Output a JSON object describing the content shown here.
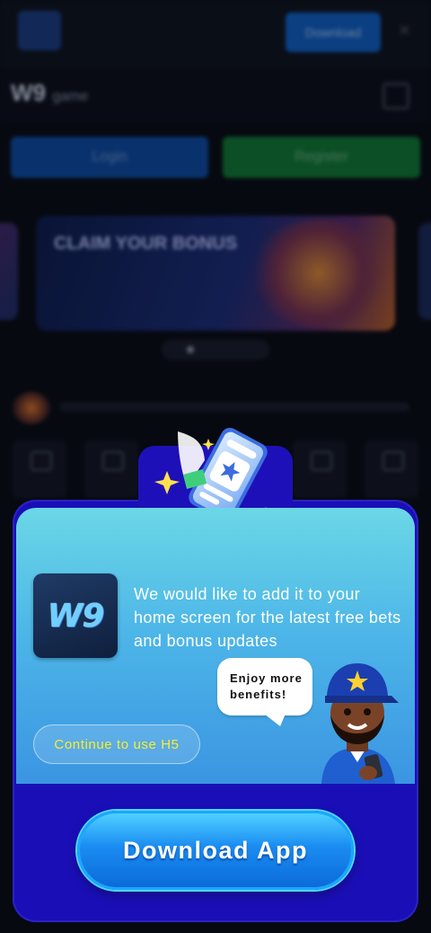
{
  "background": {
    "top_download_label": "Download",
    "brand": "W9",
    "brand_suffix": "game",
    "login_label": "Login",
    "register_label": "Register",
    "banner_title": "CLAIM YOUR BONUS"
  },
  "popup": {
    "app_icon_text": "W9",
    "message": "We would like to add it to your home screen for the latest free bets and bonus updates",
    "bubble_text": "Enjoy more benefits!",
    "continue_label": "Continue to use H5",
    "download_label": "Download App"
  },
  "colors": {
    "popup_frame": "#1a0fb7",
    "popup_gradient_top": "#6bd7e6",
    "popup_gradient_bottom": "#3b95e2",
    "continue_text": "#f6f02a",
    "download_button": "#1a8cf2"
  },
  "icons": [
    "phone-star-icon",
    "sparkle-icon",
    "mascot-icon",
    "menu-icon",
    "close-icon"
  ]
}
